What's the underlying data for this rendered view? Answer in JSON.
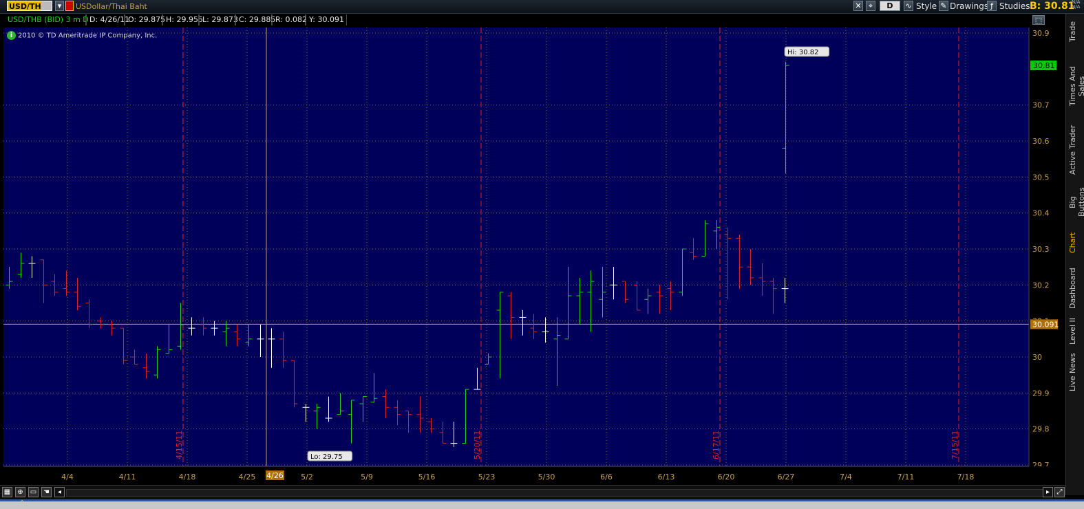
{
  "toolbar": {
    "symbol": "USD/THB",
    "symbol_name": "USDollar/Thai Baht",
    "buttons": [
      "D",
      "Style",
      "Drawings",
      "Studies"
    ],
    "bid_label": "B: 30.81",
    "na_top": "N/A",
    "na_bottom": "N/A"
  },
  "infobar": {
    "study": "USD/THB (BID) 3 m D",
    "date": "D: 4/26/11",
    "open": "O: 29.875",
    "high": "H: 29.955",
    "low": "L: 29.873",
    "close": "C: 29.885",
    "range": "R: 0.082",
    "y": "Y: 30.091"
  },
  "copyright": "2010 © TD Ameritrade IP Company, Inc.",
  "right_tabs": [
    "Trade",
    "Times And Sales",
    "Active Trader",
    "Big Buttons",
    "Chart",
    "Dashboard",
    "Level II",
    "Live News"
  ],
  "colors": {
    "background": "#00005a",
    "up": "#22d022",
    "down": "#e02020",
    "neutral": "#ffffff",
    "grid": "#7a6a3a",
    "crosshair": "#c8a050",
    "last_price_tag": "#00cc00",
    "cursor_tag": "#b07000",
    "period_line": "#e02020"
  },
  "chart_data": {
    "type": "ohlc",
    "title": "USD/THB (BID) 3 m D",
    "ylim": [
      29.7,
      30.9
    ],
    "y_ticks": [
      29.7,
      29.8,
      29.9,
      30,
      30.1,
      30.2,
      30.3,
      30.4,
      30.5,
      30.6,
      30.7,
      30.9
    ],
    "x_ticks": [
      "4/4",
      "4/11",
      "4/18",
      "4/25",
      "5/2",
      "5/9",
      "5/16",
      "5/23",
      "5/30",
      "6/6",
      "6/13",
      "6/20",
      "6/27",
      "7/4",
      "7/11",
      "7/18"
    ],
    "period_markers": [
      "4/15/11",
      "5/20/11",
      "6/17/11",
      "7/15/11"
    ],
    "hi_label": "Hi: 30.82",
    "lo_label": "Lo: 29.75",
    "last_price": "30.81",
    "cursor_price": "30.091",
    "cursor_date": "4/26",
    "bars": [
      {
        "d": "3/31",
        "o": 30.2,
        "h": 30.25,
        "l": 30.19,
        "c": 30.21
      },
      {
        "d": "4/1",
        "o": 30.23,
        "h": 30.29,
        "l": 30.22,
        "c": 30.26
      },
      {
        "d": "4/4",
        "o": 30.26,
        "h": 30.28,
        "l": 30.22,
        "c": 30.26
      },
      {
        "d": "4/5",
        "o": 30.27,
        "h": 30.27,
        "l": 30.15,
        "c": 30.2
      },
      {
        "d": "4/6",
        "o": 30.21,
        "h": 30.23,
        "l": 30.17,
        "c": 30.18
      },
      {
        "d": "4/7",
        "o": 30.19,
        "h": 30.24,
        "l": 30.17,
        "c": 30.18
      },
      {
        "d": "4/8",
        "o": 30.18,
        "h": 30.22,
        "l": 30.13,
        "c": 30.14
      },
      {
        "d": "4/11",
        "o": 30.15,
        "h": 30.16,
        "l": 30.08,
        "c": 30.09
      },
      {
        "d": "4/12",
        "o": 30.1,
        "h": 30.11,
        "l": 30.08,
        "c": 30.09
      },
      {
        "d": "4/13",
        "o": 30.09,
        "h": 30.1,
        "l": 30.06,
        "c": 30.08
      },
      {
        "d": "4/14",
        "o": 30.08,
        "h": 30.08,
        "l": 29.98,
        "c": 29.99
      },
      {
        "d": "4/15",
        "o": 30.0,
        "h": 30.02,
        "l": 29.98,
        "c": 29.98
      },
      {
        "d": "4/18",
        "o": 29.97,
        "h": 30.01,
        "l": 29.94,
        "c": 29.96
      },
      {
        "d": "4/19",
        "o": 29.95,
        "h": 30.03,
        "l": 29.94,
        "c": 30.02
      },
      {
        "d": "4/20",
        "o": 30.01,
        "h": 30.09,
        "l": 30.01,
        "c": 30.02
      },
      {
        "d": "4/21",
        "o": 30.03,
        "h": 30.15,
        "l": 30.02,
        "c": 30.09
      },
      {
        "d": "4/22",
        "o": 30.08,
        "h": 30.11,
        "l": 30.06,
        "c": 30.08
      },
      {
        "d": "4/25",
        "o": 30.09,
        "h": 30.11,
        "l": 30.06,
        "c": 30.08
      },
      {
        "d": "4/26",
        "o": 30.08,
        "h": 30.1,
        "l": 30.06,
        "c": 30.08
      },
      {
        "d": "4/27",
        "o": 30.07,
        "h": 30.1,
        "l": 30.03,
        "c": 30.08
      },
      {
        "d": "4/28",
        "o": 30.07,
        "h": 30.09,
        "l": 30.03,
        "c": 30.05
      },
      {
        "d": "4/29",
        "o": 30.04,
        "h": 30.09,
        "l": 30.03,
        "c": 30.05
      },
      {
        "d": "5/2",
        "o": 30.05,
        "h": 30.09,
        "l": 30.0,
        "c": 30.05
      },
      {
        "d": "5/3",
        "o": 30.05,
        "h": 30.08,
        "l": 29.97,
        "c": 30.05
      },
      {
        "d": "5/4",
        "o": 30.05,
        "h": 30.07,
        "l": 29.97,
        "c": 29.99
      },
      {
        "d": "5/5",
        "o": 29.99,
        "h": 29.99,
        "l": 29.86,
        "c": 29.87
      },
      {
        "d": "5/6",
        "o": 29.86,
        "h": 29.87,
        "l": 29.82,
        "c": 29.86
      },
      {
        "d": "5/9",
        "o": 29.85,
        "h": 29.87,
        "l": 29.8,
        "c": 29.86
      },
      {
        "d": "5/10",
        "o": 29.83,
        "h": 29.89,
        "l": 29.82,
        "c": 29.83
      },
      {
        "d": "5/11",
        "o": 29.84,
        "h": 29.9,
        "l": 29.84,
        "c": 29.85
      },
      {
        "d": "5/12",
        "o": 29.84,
        "h": 29.88,
        "l": 29.76,
        "c": 29.88
      },
      {
        "d": "5/13",
        "o": 29.87,
        "h": 29.89,
        "l": 29.82,
        "c": 29.89
      },
      {
        "d": "4/26x",
        "o": 29.875,
        "h": 29.955,
        "l": 29.873,
        "c": 29.885
      },
      {
        "d": "5/17",
        "o": 29.89,
        "h": 29.91,
        "l": 29.83,
        "c": 29.86
      },
      {
        "d": "5/18",
        "o": 29.86,
        "h": 29.88,
        "l": 29.81,
        "c": 29.84
      },
      {
        "d": "5/19",
        "o": 29.85,
        "h": 29.85,
        "l": 29.79,
        "c": 29.84
      },
      {
        "d": "5/20",
        "o": 29.84,
        "h": 29.89,
        "l": 29.79,
        "c": 29.83
      },
      {
        "d": "5/23",
        "o": 29.82,
        "h": 29.83,
        "l": 29.79,
        "c": 29.8
      },
      {
        "d": "5/24",
        "o": 29.79,
        "h": 29.82,
        "l": 29.76,
        "c": 29.76
      },
      {
        "d": "5/25",
        "o": 29.76,
        "h": 29.82,
        "l": 29.75,
        "c": 29.76
      },
      {
        "d": "5/26",
        "o": 29.76,
        "h": 29.91,
        "l": 29.76,
        "c": 29.91
      },
      {
        "d": "5/27",
        "o": 29.91,
        "h": 29.97,
        "l": 29.91,
        "c": 29.91
      },
      {
        "d": "5/30",
        "o": 29.98,
        "h": 30.01,
        "l": 29.98,
        "c": 30.0
      },
      {
        "d": "5/31",
        "o": 30.13,
        "h": 30.18,
        "l": 29.94,
        "c": 30.18
      },
      {
        "d": "6/1",
        "o": 30.17,
        "h": 30.18,
        "l": 30.05,
        "c": 30.11
      },
      {
        "d": "6/2",
        "o": 30.11,
        "h": 30.13,
        "l": 30.06,
        "c": 30.11
      },
      {
        "d": "6/3",
        "o": 30.08,
        "h": 30.12,
        "l": 30.05,
        "c": 30.07
      },
      {
        "d": "6/6",
        "o": 30.07,
        "h": 30.11,
        "l": 30.04,
        "c": 30.07
      },
      {
        "d": "6/7",
        "o": 30.05,
        "h": 30.11,
        "l": 29.92,
        "c": 30.06
      },
      {
        "d": "6/8",
        "o": 30.05,
        "h": 30.25,
        "l": 30.05,
        "c": 30.17
      },
      {
        "d": "6/9",
        "o": 30.17,
        "h": 30.22,
        "l": 30.09,
        "c": 30.18
      },
      {
        "d": "6/10",
        "o": 30.18,
        "h": 30.24,
        "l": 30.07,
        "c": 30.21
      },
      {
        "d": "6/13",
        "o": 30.16,
        "h": 30.25,
        "l": 30.11,
        "c": 30.18
      },
      {
        "d": "6/14",
        "o": 30.2,
        "h": 30.25,
        "l": 30.16,
        "c": 30.2
      },
      {
        "d": "6/15",
        "o": 30.21,
        "h": 30.21,
        "l": 30.15,
        "c": 30.16
      },
      {
        "d": "6/16",
        "o": 30.2,
        "h": 30.21,
        "l": 30.13,
        "c": 30.13
      },
      {
        "d": "6/17",
        "o": 30.16,
        "h": 30.19,
        "l": 30.12,
        "c": 30.17
      },
      {
        "d": "6/20",
        "o": 30.18,
        "h": 30.2,
        "l": 30.12,
        "c": 30.17
      },
      {
        "d": "6/21",
        "o": 30.19,
        "h": 30.21,
        "l": 30.13,
        "c": 30.18
      },
      {
        "d": "6/22",
        "o": 30.18,
        "h": 30.3,
        "l": 30.17,
        "c": 30.3
      },
      {
        "d": "6/23",
        "o": 30.29,
        "h": 30.33,
        "l": 30.27,
        "c": 30.28
      },
      {
        "d": "6/24",
        "o": 30.28,
        "h": 30.38,
        "l": 30.28,
        "c": 30.37
      },
      {
        "d": "6/27",
        "o": 30.35,
        "h": 30.38,
        "l": 30.3,
        "c": 30.36
      },
      {
        "d": "6/28",
        "o": 30.34,
        "h": 30.36,
        "l": 30.16,
        "c": 30.33
      },
      {
        "d": "6/29",
        "o": 30.33,
        "h": 30.34,
        "l": 30.19,
        "c": 30.25
      },
      {
        "d": "6/30",
        "o": 30.25,
        "h": 30.3,
        "l": 30.2,
        "c": 30.22
      },
      {
        "d": "7/1",
        "o": 30.22,
        "h": 30.26,
        "l": 30.17,
        "c": 30.21
      },
      {
        "d": "7/4",
        "o": 30.21,
        "h": 30.22,
        "l": 30.12,
        "c": 30.19
      },
      {
        "d": "7/5",
        "o": 30.19,
        "h": 30.22,
        "l": 30.15,
        "c": 30.19
      }
    ]
  }
}
